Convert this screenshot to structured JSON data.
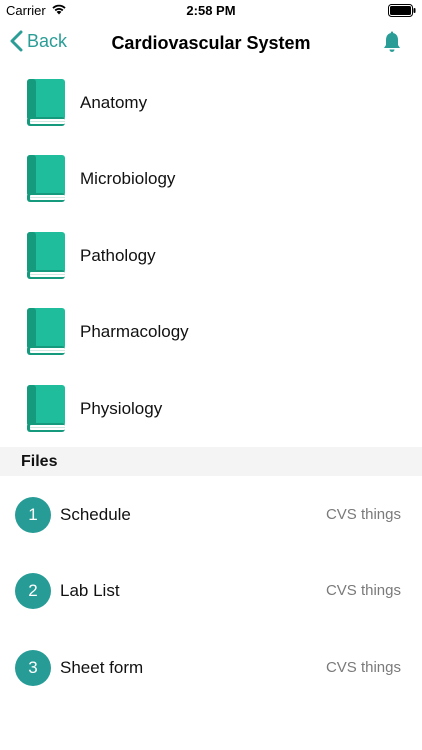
{
  "status_bar": {
    "carrier": "Carrier",
    "time": "2:58 PM",
    "icons": [
      "wifi-icon",
      "battery-icon"
    ]
  },
  "nav": {
    "back_label": "Back",
    "title": "Cardiovascular System",
    "icons": [
      "chevron-left-icon",
      "bell-icon"
    ]
  },
  "subjects": [
    {
      "label": "Anatomy",
      "icon": "book-icon"
    },
    {
      "label": "Microbiology",
      "icon": "book-icon"
    },
    {
      "label": "Pathology",
      "icon": "book-icon"
    },
    {
      "label": "Pharmacology",
      "icon": "book-icon"
    },
    {
      "label": "Physiology",
      "icon": "book-icon"
    }
  ],
  "files_section": {
    "title": "Files",
    "items": [
      {
        "number": "1",
        "name": "Schedule",
        "detail": "CVS things"
      },
      {
        "number": "2",
        "name": "Lab List",
        "detail": "CVS things"
      },
      {
        "number": "3",
        "name": "Sheet form",
        "detail": "CVS things"
      }
    ]
  },
  "colors": {
    "accent": "#2a9d97",
    "book_cover": "#1fbd9c",
    "book_spine": "#169a7e",
    "section_bg": "#f4f4f4",
    "detail_text": "#7a7a7a"
  }
}
